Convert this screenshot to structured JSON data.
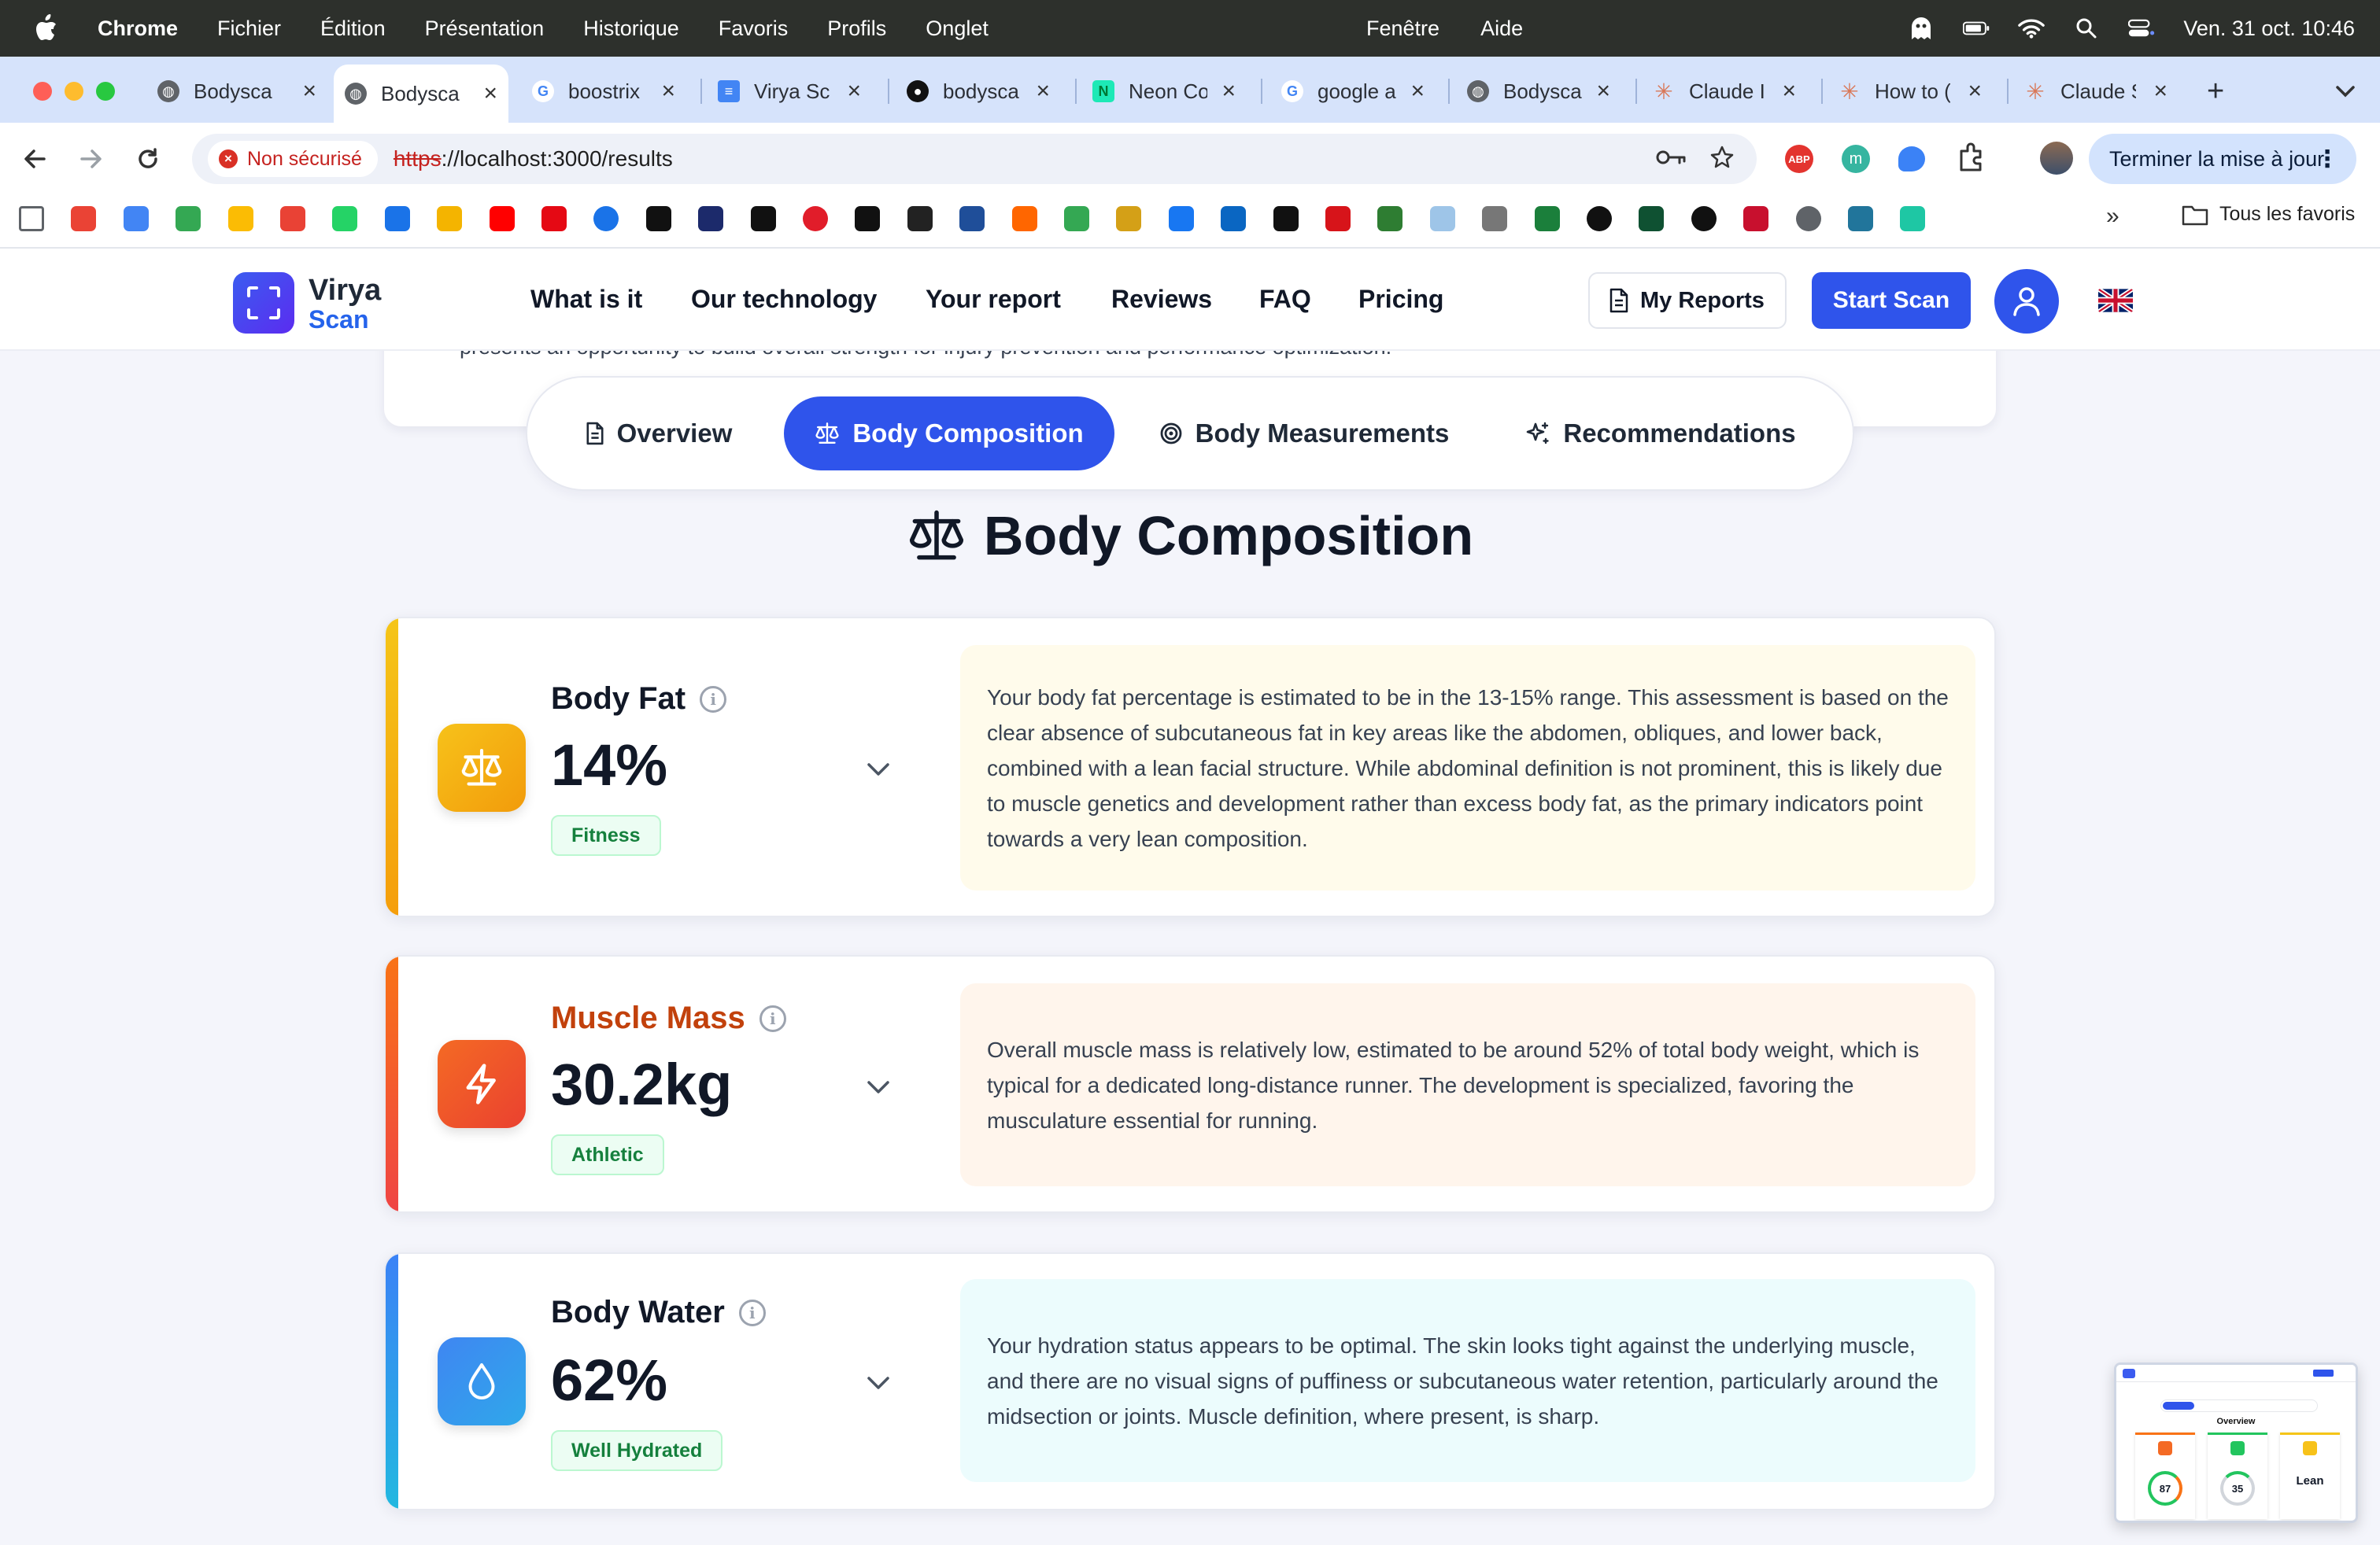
{
  "menubar": {
    "app": "Chrome",
    "items": [
      "Fichier",
      "Édition",
      "Présentation",
      "Historique",
      "Favoris",
      "Profils",
      "Onglet"
    ],
    "center_items": [
      "Fenêtre",
      "Aide"
    ],
    "clock": "Ven. 31 oct.  10:46"
  },
  "tabs": [
    {
      "label": "Bodysca",
      "icon": "globe-icon"
    },
    {
      "label": "Bodysca",
      "icon": "globe-icon"
    },
    {
      "label": "boostrix",
      "icon": "google-icon"
    },
    {
      "label": "Virya Sc",
      "icon": "docs-icon"
    },
    {
      "label": "bodysca",
      "icon": "github-icon"
    },
    {
      "label": "Neon Co",
      "icon": "neon-icon"
    },
    {
      "label": "google a",
      "icon": "google-icon"
    },
    {
      "label": "Bodysca",
      "icon": "globe-icon"
    },
    {
      "label": "Claude I",
      "icon": "claude-icon"
    },
    {
      "label": "How to (",
      "icon": "claude-icon"
    },
    {
      "label": "Claude S",
      "icon": "claude-icon"
    }
  ],
  "toolbar": {
    "security_label": "Non sécurisé",
    "url_scheme": "https",
    "url_rest": "://localhost:3000/results",
    "update_label": "Terminer la mise à jour"
  },
  "bookmarks": {
    "all_favorites": "Tous les favoris",
    "icons": [
      "apps-icon",
      "gmail-icon",
      "calendar-icon",
      "maps-icon",
      "drive-icon",
      "photos-icon",
      "whatsapp-icon",
      "messages-icon",
      "keep-icon",
      "youtube-icon",
      "netflix-icon",
      "play-icon",
      "plus-icon",
      "rmc-icon",
      "france-tv-icon",
      "radio-icon",
      "amazon-icon",
      "beacon-icon",
      "triangle-icon",
      "orange-icon",
      "dots-icon",
      "target-icon",
      "facebook-icon",
      "linkedin-icon",
      "lemonde-icon",
      "lequipe-icon",
      "chart-icon",
      "cloud-icon",
      "building-icon",
      "map-icon",
      "r-icon",
      "nvidia-icon",
      "x-icon",
      "total-icon",
      "globe-icon",
      "wordpress-icon",
      "vercel-icon"
    ]
  },
  "site": {
    "logo_line1": "Virya",
    "logo_line2": "Scan",
    "nav": [
      "What is it",
      "Our technology",
      "Your report",
      "Reviews",
      "FAQ",
      "Pricing"
    ],
    "my_reports": "My Reports",
    "start_scan": "Start Scan",
    "language": "English (UK) flag"
  },
  "previous_text": "presents an opportunity to build overall strength for injury prevention and performance optimization.",
  "report_tabs": [
    {
      "label": "Overview",
      "icon": "document-icon",
      "active": false
    },
    {
      "label": "Body Composition",
      "icon": "scale-icon",
      "active": true
    },
    {
      "label": "Body Measurements",
      "icon": "target-icon",
      "active": false
    },
    {
      "label": "Recommendations",
      "icon": "sparkles-icon",
      "active": false
    }
  ],
  "section_title": "Body Composition",
  "metrics": [
    {
      "name": "Body Fat",
      "value": "14%",
      "badge": "Fitness",
      "icon": "scale-icon",
      "name_color": "#111827",
      "accent": [
        "#f5c518",
        "#f59e0b"
      ],
      "icon_bg": [
        "#f7c21a",
        "#f29b0b"
      ],
      "desc_bg": "#fffbeb",
      "description": "Your body fat percentage is estimated to be in the 13-15% range. This assessment is based on the clear absence of subcutaneous fat in key areas like the abdomen, obliques, and lower back, combined with a lean facial structure. While abdominal definition is not prominent, this is likely due to muscle genetics and development rather than excess body fat, as the primary indicators point towards a very lean composition."
    },
    {
      "name": "Muscle Mass",
      "value": "30.2kg",
      "badge": "Athletic",
      "icon": "lightning-icon",
      "name_color": "#c2410c",
      "accent": [
        "#f97316",
        "#ef4444"
      ],
      "icon_bg": [
        "#f46a24",
        "#ea4130"
      ],
      "desc_bg": "#fff5ec",
      "description": "Overall muscle mass is relatively low, estimated to be around 52% of total body weight, which is typical for a dedicated long-distance runner. The development is specialized, favoring the musculature essential for running."
    },
    {
      "name": "Body Water",
      "value": "62%",
      "badge": "Well Hydrated",
      "icon": "droplet-icon",
      "name_color": "#111827",
      "accent": [
        "#3b82f6",
        "#22b8e0"
      ],
      "icon_bg": [
        "#3f86f2",
        "#2fa8ea"
      ],
      "desc_bg": "#ecfcfd",
      "description": "Your hydration status appears to be optimal. The skin looks tight against the underlying muscle, and there are no visual signs of puffiness or subcutaneous water retention, particularly around the midsection or joints. Muscle definition, where present, is sharp."
    }
  ],
  "thumbnail": {
    "title": "Overview",
    "score_1": "87",
    "score_2": "35",
    "label_3": "Lean"
  }
}
